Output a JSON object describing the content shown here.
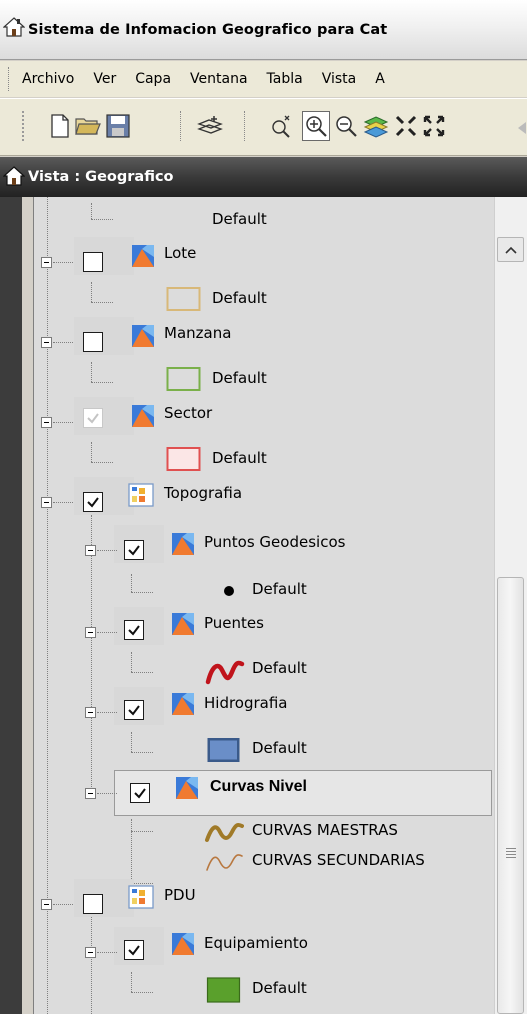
{
  "window": {
    "title": "Sistema de Infomacion  Geografico para Cat"
  },
  "menu": [
    "Archivo",
    "Ver",
    "Capa",
    "Ventana",
    "Tabla",
    "Vista",
    "A"
  ],
  "toolbar": {
    "buttons": [
      "new-document-icon",
      "open-folder-icon",
      "save-icon",
      "add-layer-icon",
      "pan-icon",
      "zoom-in-icon",
      "zoom-out-icon",
      "layers-icon",
      "zoom-extent-in-icon",
      "zoom-extent-out-icon"
    ],
    "active": "zoom-in-icon"
  },
  "vista": {
    "title": "Vista : Geografico"
  },
  "tree": {
    "default_label": "Default",
    "layers": {
      "lote": "Lote",
      "manzana": "Manzana",
      "sector": "Sector",
      "topografia": "Topografia",
      "puntos": "Puntos Geodesicos",
      "puentes": "Puentes",
      "hidrografia": "Hidrografia",
      "curvas": "Curvas Nivel",
      "curvas_maestras": "CURVAS MAESTRAS",
      "curvas_secundarias": "CURVAS SECUNDARIAS",
      "pdu": "PDU",
      "equipamiento": "Equipamiento"
    }
  },
  "colors": {
    "lote_symbol": "#d8b878",
    "manzana_symbol": "#7ab04a",
    "sector_symbol": "#e05050",
    "puentes_symbol": "#c0141c",
    "hidrografia_fill": "#6a8ec8",
    "hidrografia_border": "#3a5a8a",
    "curvas_maestras": "#a07a28",
    "curvas_secundarias": "#b87840",
    "equipamiento_fill": "#5aa02c"
  }
}
